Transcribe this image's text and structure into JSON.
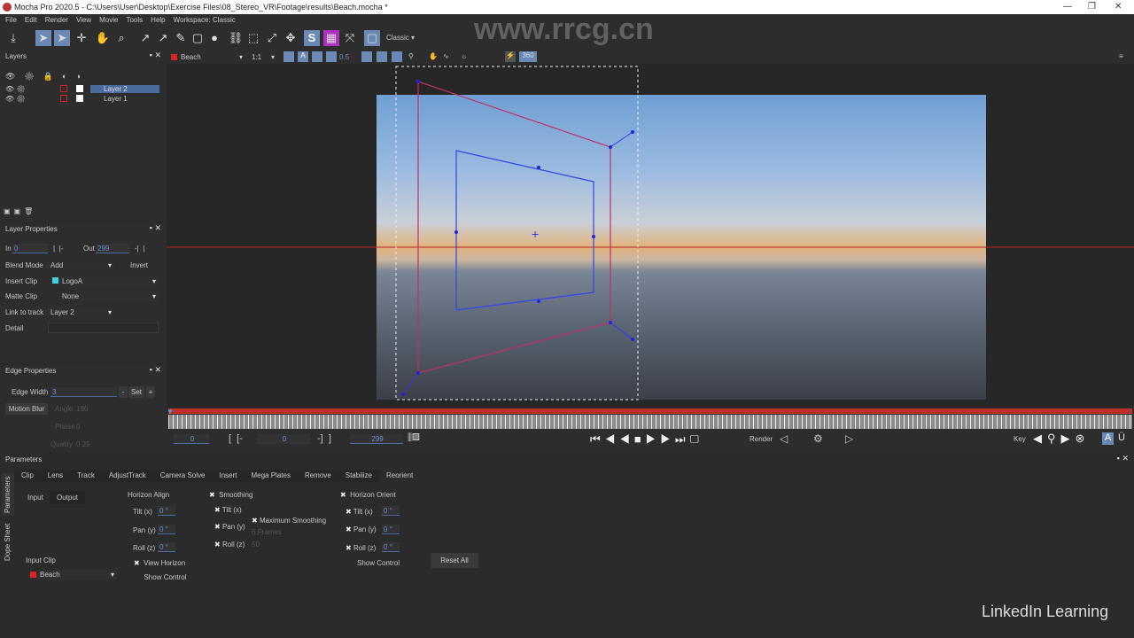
{
  "title": "Mocha Pro 2020.5 - C:\\Users\\User\\Desktop\\Exercise Files\\08_Stereo_VR\\Footage\\results\\Beach.mocha *",
  "menu": [
    "File",
    "Edit",
    "Render",
    "View",
    "Movie",
    "Tools",
    "Help",
    "Workspace: Classic"
  ],
  "toolbar": {
    "workspace": "Classic"
  },
  "viewer_bar": {
    "clip": "Beach",
    "zoom": "1:1",
    "opacity": "0.5",
    "vr": "360"
  },
  "layers": {
    "title": "Layers",
    "items": [
      {
        "name": "Layer 2",
        "selected": true
      },
      {
        "name": "Layer 1",
        "selected": false
      }
    ]
  },
  "layer_props": {
    "title": "Layer Properties",
    "in_label": "In",
    "in_value": "0",
    "out_label": "Out",
    "out_value": "299",
    "blend_label": "Blend Mode",
    "blend_value": "Add",
    "invert": "Invert",
    "insert_label": "Insert Clip",
    "insert_value": "LogoA",
    "matte_label": "Matte Clip",
    "matte_value": "None",
    "link_label": "Link to track",
    "link_value": "Layer 2",
    "detail_label": "Detail"
  },
  "edge_props": {
    "title": "Edge Properties",
    "width_label": "Edge Width",
    "width_value": "3",
    "set": "Set",
    "minus": "-",
    "plus": "+",
    "motion_blur": "Motion Blur",
    "angle": "Angle",
    "angle_value": "180",
    "phase": "Phase",
    "phase_value": "0",
    "quality": "Quality",
    "quality_value": "0.25"
  },
  "timeline": {
    "start": "0",
    "in": "0",
    "out": "299",
    "render": "Render",
    "key": "Key"
  },
  "params": {
    "title": "Parameters",
    "side_tabs": [
      "Parameters",
      "Dope Sheet"
    ],
    "tabs": [
      "Clip",
      "Lens",
      "Track",
      "AdjustTrack",
      "Camera Solve",
      "Insert",
      "Mega Plates",
      "Remove",
      "Stabilize",
      "Reorient"
    ],
    "sub_tabs": [
      "Input",
      "Output"
    ],
    "horizon_align": {
      "title": "Horizon Align",
      "tilt": "Tilt (x)",
      "pan": "Pan (y)",
      "roll": "Roll (z)",
      "tilt_v": "0 °",
      "pan_v": "0 °",
      "roll_v": "0 °",
      "view_horizon": "View Horizon",
      "show_control": "Show Control"
    },
    "smoothing": {
      "title": "Smoothing",
      "tilt": "Tilt (x)",
      "pan": "Pan (y)",
      "roll": "Roll (z)",
      "max": "Maximum Smoothing",
      "frames": "6 Frames",
      "roll_v": "50"
    },
    "horizon_orient": {
      "title": "Horizon Orient",
      "tilt": "Tilt (x)",
      "pan": "Pan (y)",
      "roll": "Roll (z)",
      "tilt_v": "0 °",
      "pan_v": "0 °",
      "roll_v": "0 °",
      "show_control": "Show Control"
    },
    "reset": "Reset All",
    "input_clip_label": "Input Clip",
    "input_clip": "Beach"
  },
  "watermark": {
    "site": "www.rrcg.cn",
    "brand": "LinkedIn Learning"
  }
}
